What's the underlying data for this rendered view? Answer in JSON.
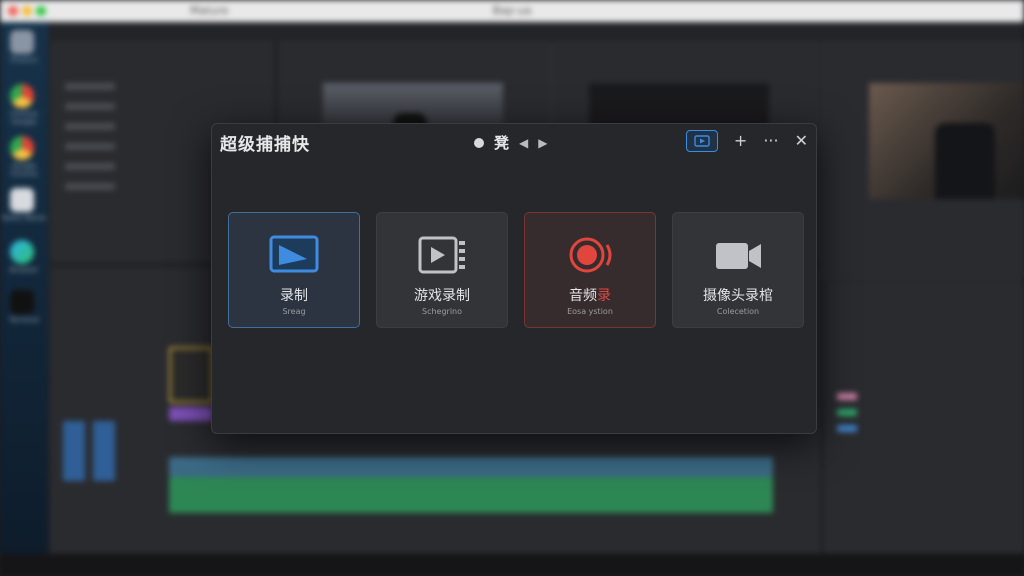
{
  "os_bar": {
    "title": "Bap·ua",
    "app_name": "Mature"
  },
  "dock": {
    "items": [
      {
        "label": "Finance",
        "icon": "folder-icon"
      },
      {
        "label": "Chrome Google",
        "icon": "chrome-icon"
      },
      {
        "label": "Google Chrome",
        "icon": "chrome-icon"
      },
      {
        "label": "Notes Memo",
        "icon": "notes-icon"
      },
      {
        "label": "Browser",
        "icon": "edge-icon"
      },
      {
        "label": "Terminal",
        "icon": "terminal-icon"
      }
    ]
  },
  "dialog": {
    "title": "超级捕捕快",
    "mode_label": "凳",
    "buttons": {
      "add": "+",
      "more": "···",
      "close": "✕"
    },
    "cards": [
      {
        "label": "录制",
        "sub": "Sreag",
        "icon": "screen-record-icon",
        "state": "selected"
      },
      {
        "label": "游戏录制",
        "sub": "Schegrino",
        "icon": "game-record-icon",
        "state": "normal"
      },
      {
        "label_main": "音频",
        "label_red": "录",
        "sub": "Eosa ystion",
        "icon": "audio-record-icon",
        "state": "red"
      },
      {
        "label": "摄像头录棺",
        "sub": "Colecetion",
        "icon": "camera-record-icon",
        "state": "normal"
      }
    ]
  },
  "colors": {
    "accent_blue": "#3f8be0",
    "record_red": "#e0463e",
    "dialog_bg": "#26272a"
  }
}
